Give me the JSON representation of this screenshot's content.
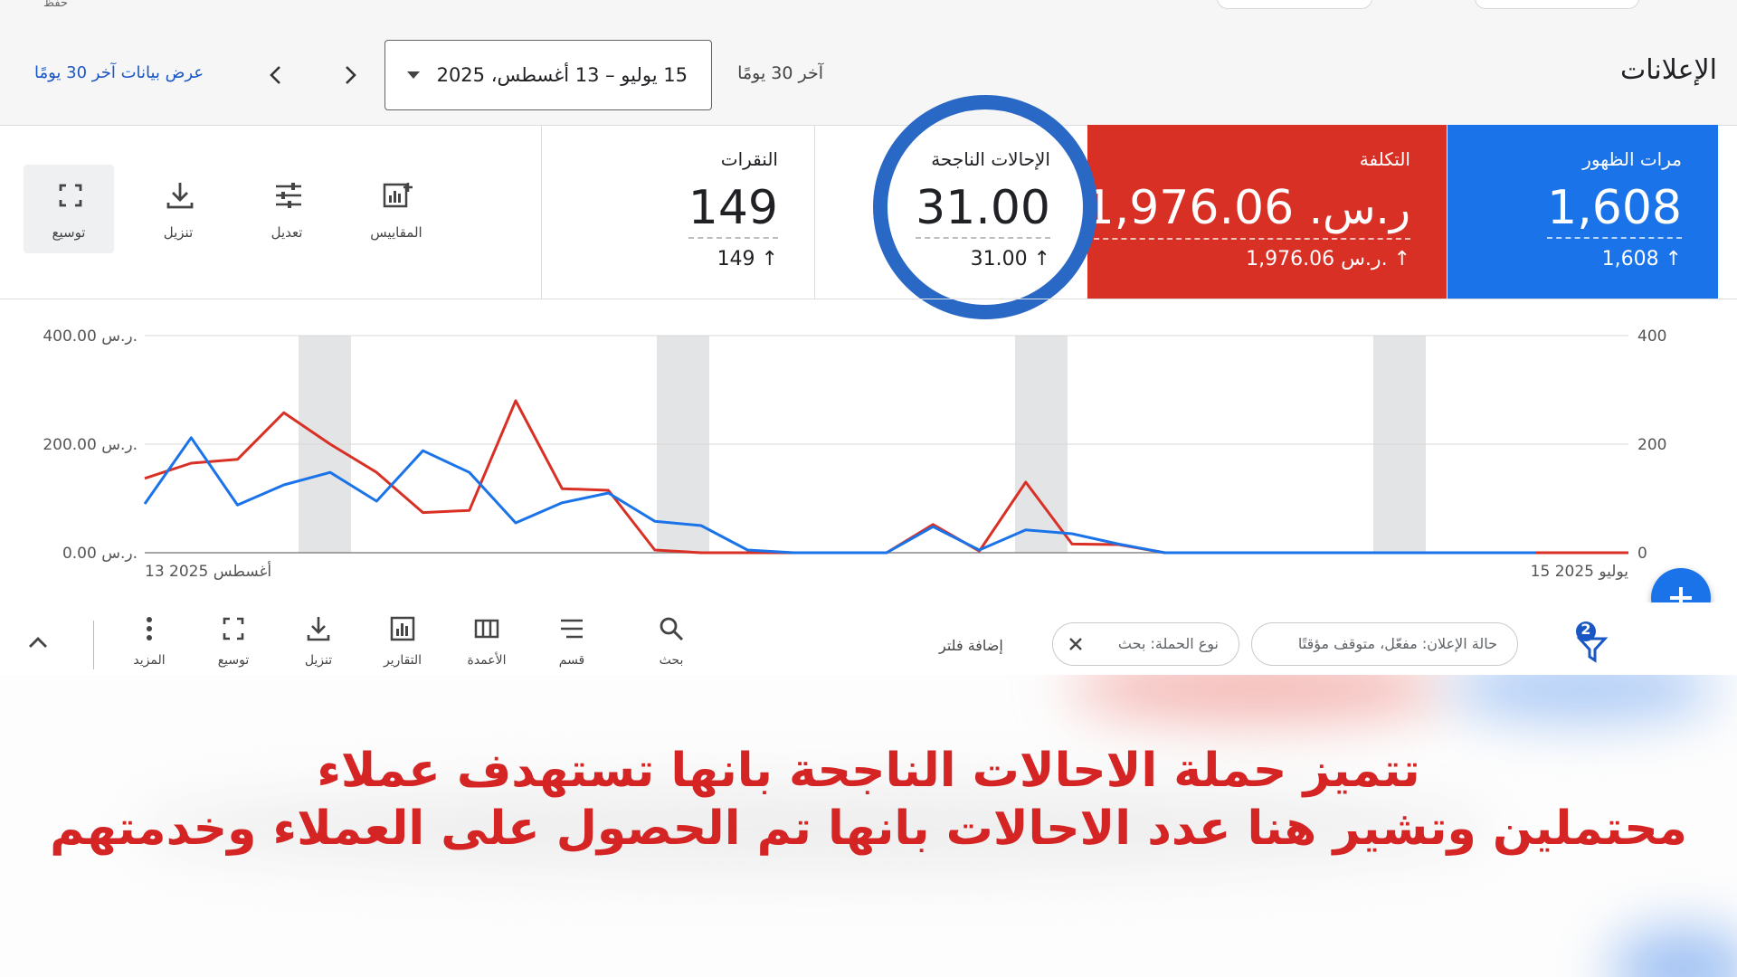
{
  "top": {
    "save_label": "حفظ"
  },
  "header": {
    "title": "الإعلانات",
    "last_days_label": "آخر 30 يومًا",
    "date_range": "15 يوليو – 13 أغسطس، 2025",
    "view_last_30": "عرض بيانات آخر 30 يومًا"
  },
  "tools": [
    {
      "label": "المقاييس",
      "icon": "metrics-icon"
    },
    {
      "label": "تعديل",
      "icon": "tune-icon"
    },
    {
      "label": "تنزيل",
      "icon": "download-icon"
    },
    {
      "label": "توسيع",
      "icon": "expand-icon"
    }
  ],
  "metrics": {
    "impressions": {
      "label": "مرات الظهور",
      "value": "1,608",
      "sub": "1,608",
      "color": "#1a73e8"
    },
    "cost": {
      "label": "التكلفة",
      "value": "1,976.06",
      "currency": "ر.س.",
      "sub": "1,976.06 ر.س.",
      "color": "#d93025"
    },
    "conversions": {
      "label": "الإحالات الناجحة",
      "value": "31.00",
      "sub": "31.00"
    },
    "clicks": {
      "label": "النقرات",
      "value": "149",
      "sub": "149"
    }
  },
  "chart_data": {
    "type": "line",
    "x_start_label": "15 يوليو 2025",
    "x_end_label": "13 أغسطس 2025",
    "left_axis_ticks": [
      "400.00 ر.س.",
      "200.00 ر.س.",
      "0.00 ر.س."
    ],
    "right_axis_ticks": [
      "400",
      "200",
      "0"
    ],
    "ylim": [
      0,
      400
    ],
    "grid": true,
    "series": [
      {
        "color": "#d93025",
        "values": [
          0,
          0,
          0,
          0,
          0,
          0,
          0,
          0,
          0,
          0,
          0,
          15,
          16,
          130,
          3,
          52,
          0,
          0,
          0,
          0,
          0,
          5,
          115,
          118,
          280,
          78,
          74,
          148,
          200,
          258,
          172,
          165,
          137
        ]
      },
      {
        "color": "#1a73e8",
        "values": [
          0,
          0,
          0,
          0,
          0,
          0,
          0,
          0,
          0,
          16,
          35,
          42,
          5,
          48,
          0,
          0,
          0,
          5,
          50,
          58,
          110,
          92,
          55,
          148,
          188,
          95,
          148,
          125,
          88,
          212,
          90
        ]
      }
    ]
  },
  "bottom_tools": [
    {
      "label": "بحث",
      "icon": "search-icon"
    },
    {
      "label": "قسم",
      "icon": "segment-icon"
    },
    {
      "label": "الأعمدة",
      "icon": "columns-icon"
    },
    {
      "label": "التقارير",
      "icon": "reports-icon"
    },
    {
      "label": "تنزيل",
      "icon": "download-icon"
    },
    {
      "label": "توسيع",
      "icon": "expand-icon"
    },
    {
      "label": "المزيد",
      "icon": "more-icon"
    }
  ],
  "filters": {
    "badge_count": "2",
    "chip_status": "حالة الإعلان: مفعّل، متوقف مؤقتًا",
    "chip_campaign": "نوع الحملة: بحث",
    "add_filter": "إضافة فلتر"
  },
  "caption": {
    "line1": "تتميز حملة الاحالات الناجحة بانها تستهدف عملاء",
    "line2": "محتملين  وتشير هنا عدد الاحالات بانها تم الحصول على العملاء وخدمتهم"
  }
}
